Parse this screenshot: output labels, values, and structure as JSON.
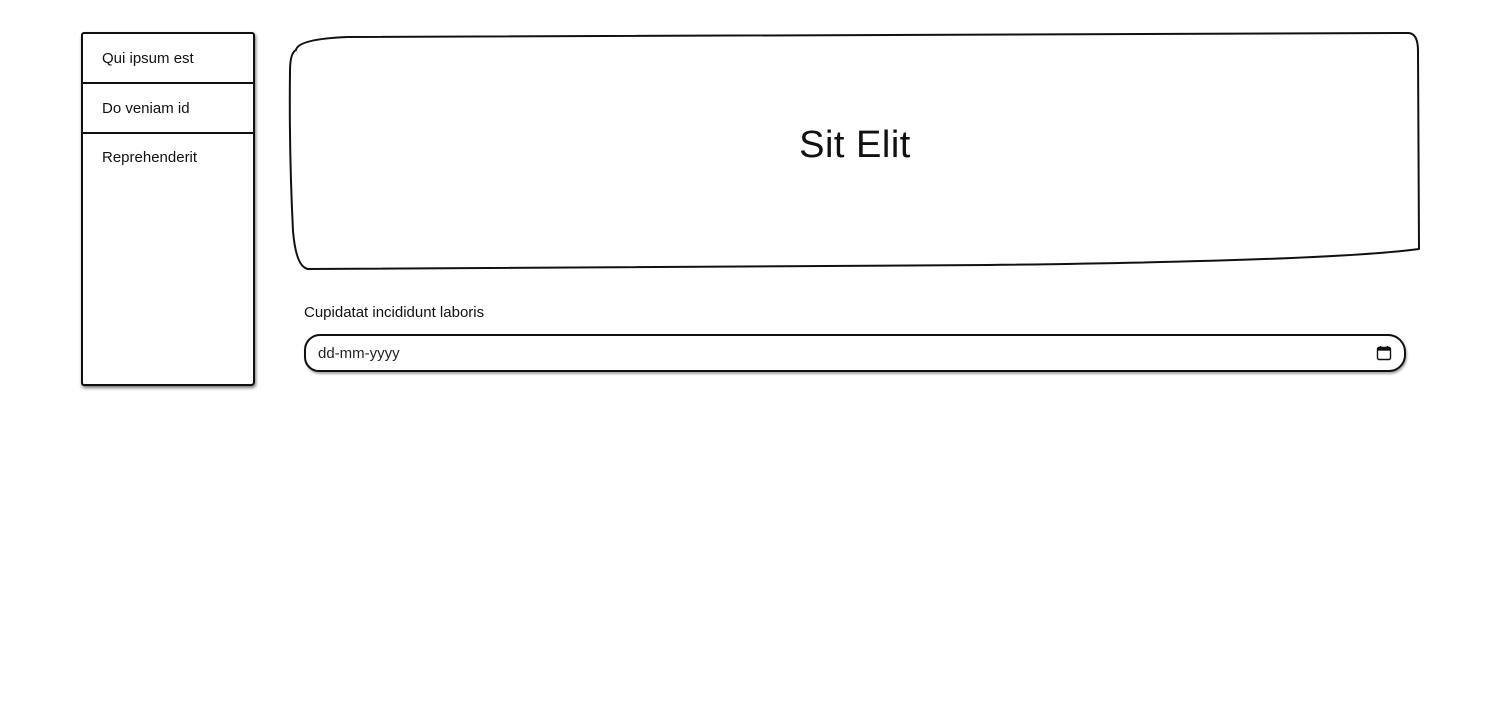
{
  "sidebar": {
    "items": [
      {
        "label": "Qui ipsum est"
      },
      {
        "label": "Do veniam id"
      },
      {
        "label": "Reprehenderit"
      }
    ]
  },
  "hero": {
    "title": "Sit Elit"
  },
  "form": {
    "date_field": {
      "label": "Cupidatat incididunt laboris",
      "placeholder": "dd-mm-yyyy",
      "icon": "calendar-icon"
    }
  }
}
